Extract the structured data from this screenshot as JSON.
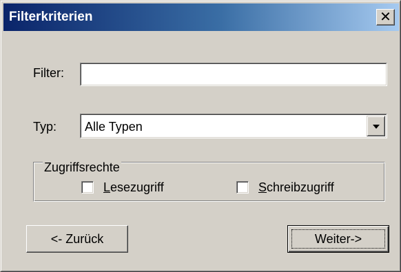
{
  "window": {
    "title": "Filterkriterien",
    "close_glyph": "✕"
  },
  "filter": {
    "label": "Filter:",
    "value": ""
  },
  "typ": {
    "label": "Typ:",
    "selected": "Alle Typen"
  },
  "access_rights": {
    "legend": "Zugriffsrechte",
    "read": {
      "mnemonic": "L",
      "rest": "esezugriff",
      "checked": false
    },
    "write": {
      "mnemonic": "S",
      "rest": "chreibzugriff",
      "checked": false
    }
  },
  "buttons": {
    "back": "<- Zurück",
    "next": "Weiter->"
  },
  "colors": {
    "titlebar_start": "#0a246a",
    "titlebar_end": "#a6caf0",
    "dialog_face": "#d4d0c8"
  }
}
